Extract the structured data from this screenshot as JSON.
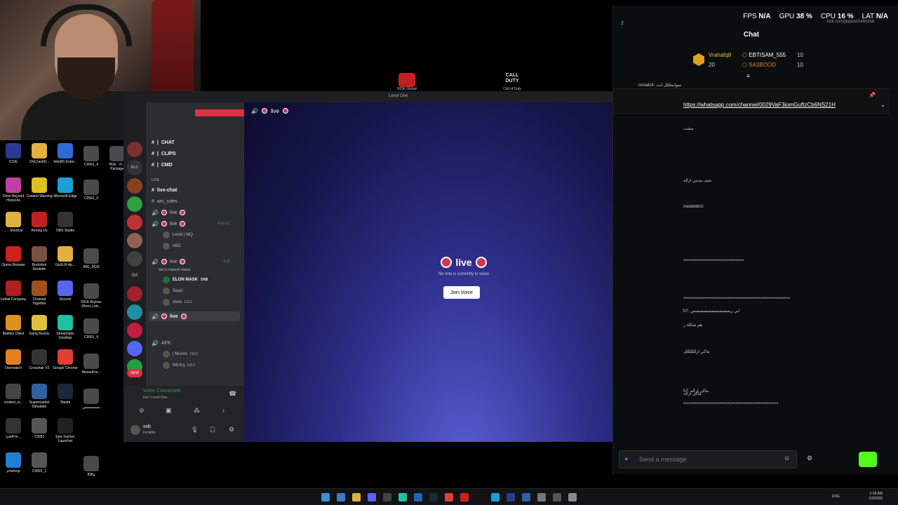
{
  "webcam": {},
  "desktop_icons": [
    {
      "label": "iCUE",
      "color": "#2a3b8f"
    },
    {
      "label": "CfxCrashD...",
      "color": "#e0b040"
    },
    {
      "label": "Intel(R) Extre...",
      "color": "#2d6bd6"
    },
    {
      "label": "Drive Beyond Horizons",
      "color": "#c23fa0"
    },
    {
      "label": "Content Warning",
      "color": "#e0c020"
    },
    {
      "label": "Microsoft Edge",
      "color": "#1a9fd6"
    },
    {
      "label": "... - Shortcut",
      "color": "#e0b040"
    },
    {
      "label": "Among Us",
      "color": "#c02020"
    },
    {
      "label": "OBS Studio",
      "color": "#333"
    },
    {
      "label": "Opera Browser",
      "color": "#d02020"
    },
    {
      "label": "Buckshot Roulette",
      "color": "#7a5040"
    },
    {
      "label": "GoXLR-Ap...",
      "color": "#e0b040"
    },
    {
      "label": "Lethal Company",
      "color": "#b02020"
    },
    {
      "label": "Chained Together",
      "color": "#a05020"
    },
    {
      "label": "Discord",
      "color": "#5865f2"
    },
    {
      "label": "Badlion Client",
      "color": "#e09020"
    },
    {
      "label": "Gang Beasts",
      "color": "#e0c040"
    },
    {
      "label": "Streamlabs Desktop",
      "color": "#20c0a0"
    },
    {
      "label": "Overwatch",
      "color": "#e08020"
    },
    {
      "label": "Crosshair V2",
      "color": "#333"
    },
    {
      "label": "Google Chrome",
      "color": "#e04030"
    },
    {
      "label": "content_w...",
      "color": "#444"
    },
    {
      "label": "Supermarket Simulator",
      "color": "#3060a0"
    },
    {
      "label": "Steam",
      "color": "#1b2838"
    },
    {
      "label": "IمanFre...",
      "color": "#333"
    },
    {
      "label": "C9991",
      "color": "#555"
    },
    {
      "label": "Epic Games Launcher",
      "color": "#222"
    },
    {
      "label": "مmeloop",
      "color": "#2080d0"
    },
    {
      "label": "C9991_1",
      "color": "#555"
    }
  ],
  "desktop_extra": [
    {
      "label": "C9991_4"
    },
    {
      "label": "NVE - Fi... Package"
    },
    {
      "label": "C9991_5"
    },
    {
      "label": "IMG_9618"
    },
    {
      "label": "KKIA Skytrax (Horiz.) ed..."
    },
    {
      "label": "C9991_6"
    },
    {
      "label": "NissanFra..."
    },
    {
      "label": "بسسسسس"
    },
    {
      "label": "و838"
    }
  ],
  "center_icons": [
    {
      "label": "RISK Global",
      "color": "#d02020"
    },
    {
      "label": "Call of Duty",
      "color": "#ddd"
    }
  ],
  "discord": {
    "window_title": "Level One",
    "channels": [
      {
        "name": "CHAT",
        "type": "text"
      },
      {
        "name": "CLIPS",
        "type": "text"
      },
      {
        "name": "CMD",
        "type": "text"
      }
    ],
    "category_live": "LIVE",
    "live_chat": "live-chat",
    "arc_rules": "arc_rules",
    "voice_channels": [
      {
        "name": "live",
        "timer": ""
      },
      {
        "name": "live",
        "timer": "4:55:21"
      },
      {
        "name": "live",
        "timer": "5:35"
      },
      {
        "name": "live",
        "timer": ""
      }
    ],
    "vc_users_a": [
      {
        "name": "Level | MQ"
      },
      {
        "name": "M92"
      }
    ],
    "set_status": "Set a channel status",
    "vc_users_b": [
      {
        "name": "ELON MASK",
        "tag": "SXB"
      },
      {
        "name": "Saad",
        "tag": ""
      },
      {
        "name": "xlxwi",
        "tag": "LVL1"
      }
    ],
    "afk": "AFK",
    "afk_users": [
      {
        "name": "| Muvxo",
        "tag": "LVL1"
      },
      {
        "name": "iMLKq",
        "tag": "LVL1"
      }
    ],
    "voice_connected": "Voice Connected",
    "voice_location": "live / Level One",
    "username": "sxb",
    "user_status": "Invisible",
    "server_labels": [
      "RLC",
      "GA",
      "NEW"
    ],
    "stage": {
      "header_name": "live",
      "title": "live",
      "subtitle": "No one is currently in voice",
      "join": "Join Voice"
    }
  },
  "chat": {
    "url": "kick.com/popout/sxb/chat",
    "title": "Chat",
    "stats": {
      "fps_label": "FPS",
      "fps": "N/A",
      "gpu_label": "GPU",
      "gpu": "38 %",
      "cpu_label": "CPU",
      "cpu": "16 %",
      "lat_label": "LAT",
      "lat": "N/A"
    },
    "leaders": [
      {
        "name": "Vrahafq8",
        "count": "20"
      },
      {
        "name": "EBTISAM_555",
        "count": "10"
      },
      {
        "name": "SA3BOOD",
        "count": "10"
      }
    ],
    "pinned_link": "https://whatsapp.com/channel/0029VaF3iomGufIzCb6NS21H",
    "lines": [
      "ismailz4: متواسلللل انت",
      "مشت",
      "شف مدمن ازاله",
      "medeldin3:",
      "*************************************",
      "*****************************************************************",
      "h7: ابي زبسسسسسسسسسس",
      "هم شكله ر",
      "ماكي ازلللللللل",
      "ماكي ازاله",
      "h7: ماكي ازاله",
      "**********************************************************"
    ],
    "input_placeholder": "Send a message"
  },
  "taskbar": {
    "lang": "ENG",
    "time": "2:28 AM",
    "date": "2/3/2026"
  }
}
